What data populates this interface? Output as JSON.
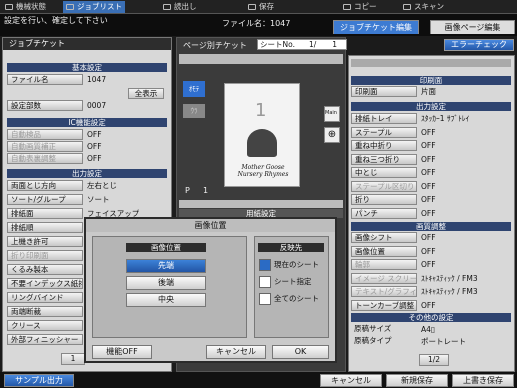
{
  "top_tabs": [
    "機械状態",
    "ジョブリスト",
    "読出し",
    "保存",
    "コピー",
    "スキャン"
  ],
  "info": {
    "message": "設定を行い、確定して下さい",
    "file_label": "ファイル名：1047"
  },
  "tabs": {
    "job_ticket_edit": "ジョブチケット編集",
    "page_edit": "画像ページ編集"
  },
  "left": {
    "title": "ジョブチケット",
    "basic_title": "基本設定",
    "filename_btn": "ファイル名",
    "filename_val": "1047",
    "show_all": "全表示",
    "copies_btn": "設定部数",
    "copies_val": "0007",
    "ic_title": "IC機能設定",
    "ic_rows": [
      {
        "label": "自動検品",
        "value": "OFF"
      },
      {
        "label": "自動画質補正",
        "value": "OFF"
      },
      {
        "label": "自動表裏調整",
        "value": "OFF"
      }
    ],
    "output_title": "出力設定",
    "output_rows": [
      {
        "label": "両面とじ方向",
        "value": "左右とじ"
      },
      {
        "label": "ソート/グループ",
        "value": "ソート"
      },
      {
        "label": "排紙面",
        "value": "フェイスアップ"
      },
      {
        "label": "排紙順",
        "value": ""
      },
      {
        "label": "上機き許可",
        "value": ""
      },
      {
        "label": "折り印刷面",
        "value": ""
      },
      {
        "label": "くるみ製本",
        "value": ""
      },
      {
        "label": "不要インデックス紙排紙",
        "value": ""
      },
      {
        "label": "リングバインド",
        "value": ""
      },
      {
        "label": "両端断裁",
        "value": ""
      },
      {
        "label": "クリース",
        "value": ""
      },
      {
        "label": "外部フィニッシャー",
        "value": ""
      }
    ],
    "page_num": "1"
  },
  "middle": {
    "title": "ページ別チケット",
    "sheet_label": "シートNo.",
    "sheet_val": "1/",
    "sheet_total": "1",
    "thumb_label": "ｵﾓﾃ",
    "thumb2": "ｳﾗ",
    "page_letter": "P",
    "page_num": "1",
    "paper_title": "用紙設定",
    "main_label": "Main",
    "book_title": "Mother Goose Nursery Rhymes"
  },
  "error_check": "エラーチェック",
  "right": {
    "print_title": "印刷面",
    "print_btn": "印刷面",
    "print_val": "片面",
    "out_title": "出力設定",
    "out_rows": [
      {
        "label": "排紙トレイ",
        "value": "ｽﾀｯｶｰ1 ｻﾌﾞﾄﾚｲ"
      },
      {
        "label": "ステープル",
        "value": "OFF"
      },
      {
        "label": "重ね中折り",
        "value": "OFF"
      },
      {
        "label": "重ね三つ折り",
        "value": "OFF"
      },
      {
        "label": "中とじ",
        "value": "OFF"
      },
      {
        "label": "ステープル区切り",
        "value": "OFF"
      },
      {
        "label": "折り",
        "value": "OFF"
      },
      {
        "label": "パンチ",
        "value": "OFF"
      }
    ],
    "img_title": "画質調整",
    "img_rows": [
      {
        "label": "画像シフト",
        "value": "OFF"
      },
      {
        "label": "画像位置",
        "value": "OFF"
      },
      {
        "label": "輪郭",
        "value": "OFF"
      },
      {
        "label": "イメージ スクリーン",
        "value": "ｽﾄｷｬｽﾃｨｯｸ / FM3"
      },
      {
        "label": "テキスト/グラフィック スクリーン",
        "value": "ｽﾄｷｬｽﾃｨｯｸ / FM3"
      },
      {
        "label": "トーンカーブ調整",
        "value": "OFF"
      }
    ],
    "other_title": "その他の設定",
    "other_rows": [
      {
        "label": "原稿サイズ",
        "value": "A4▯"
      },
      {
        "label": "原稿タイプ",
        "value": "ポートレート"
      }
    ],
    "page": "1/2"
  },
  "dialog": {
    "title": "画像位置",
    "group1_title": "画像位置",
    "opt_top": "先端",
    "opt_back": "後端",
    "opt_center": "中央",
    "group2_title": "反映先",
    "chk1": "現在のシート",
    "chk2": "シート指定",
    "chk3": "全てのシート",
    "func_off": "機能OFF",
    "cancel": "キャンセル",
    "ok": "OK"
  },
  "bottom": {
    "sample": "サンプル出力",
    "cancel": "キャンセル",
    "new_save": "新規保存",
    "overwrite": "上書き保存"
  }
}
